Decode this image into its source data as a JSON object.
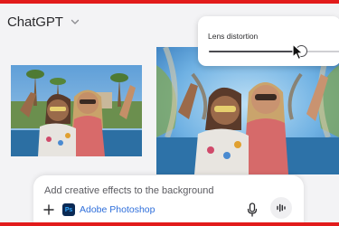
{
  "app": {
    "title": "ChatGPT"
  },
  "icons": {
    "model_menu": "chevron-down-icon",
    "add": "plus-icon",
    "tool": "photoshop-icon",
    "mic": "microphone-icon",
    "voice": "voice-waveform-icon",
    "cursor": "mouse-pointer-icon"
  },
  "images": {
    "original": "photo-original",
    "edited": "photo-edited"
  },
  "slider": {
    "label": "Lens distortion",
    "value_fraction": 0.7
  },
  "composer": {
    "prompt": "Add creative effects to the background",
    "tool_label": "Adobe Photoshop",
    "tool_icon_text": "Ps"
  },
  "colors": {
    "accent_stripe": "#e21b1b",
    "tool_label": "#2f6fdb",
    "photoshop_bg": "#0a2a55",
    "photoshop_text": "#33a8ff"
  }
}
